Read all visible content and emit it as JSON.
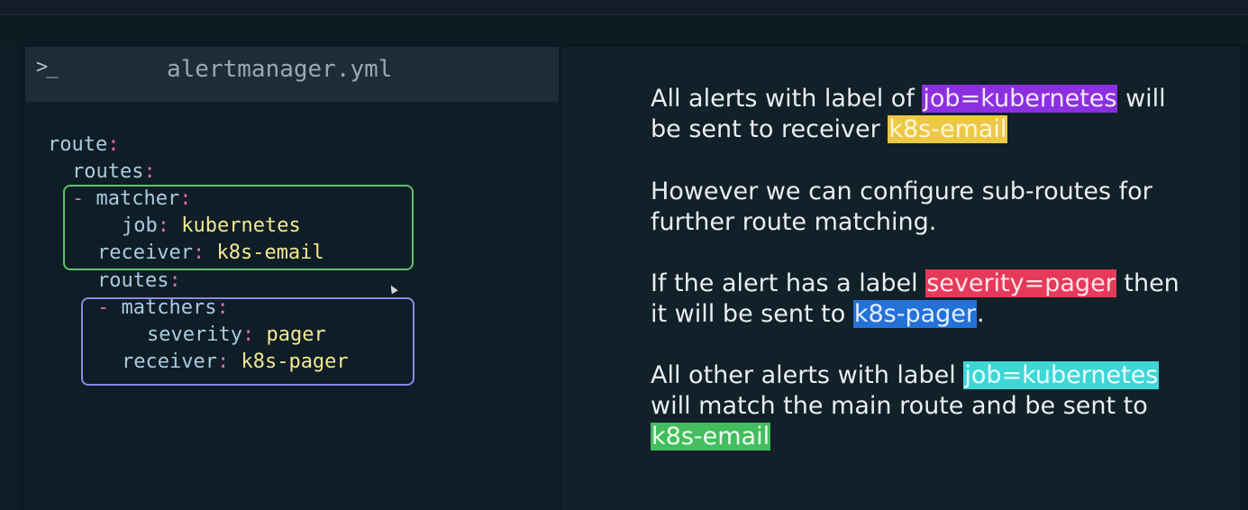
{
  "editor": {
    "prompt_icon": ">_",
    "filename": "alertmanager.yml",
    "lines": [
      {
        "key": "route",
        "punct": ":",
        "value": ""
      },
      {
        "key": "routes",
        "punct": ":",
        "value": ""
      },
      {
        "dash": "- ",
        "key": "matcher",
        "punct": ":",
        "value": ""
      },
      {
        "key": "job",
        "punct": ":",
        "value": " kubernetes"
      },
      {
        "key": "receiver",
        "punct": ":",
        "value": " k8s-email"
      },
      {
        "key": "routes",
        "punct": ":",
        "value": ""
      },
      {
        "dash": "- ",
        "key": "matchers",
        "punct": ":",
        "value": ""
      },
      {
        "key": "severity",
        "punct": ":",
        "value": " pager"
      },
      {
        "key": "receiver",
        "punct": ":",
        "value": " k8s-pager"
      }
    ]
  },
  "explanation": {
    "p1": {
      "line1_pre": "All alerts with label of ",
      "line1_hl": "job=kubernetes",
      "line1_post": " will",
      "line2_pre": "be sent to receiver ",
      "line2_hl": "k8s-email"
    },
    "p2": {
      "line1": "However we can configure sub-routes for",
      "line2": "further route matching."
    },
    "p3": {
      "line1_pre": "If the alert has a label ",
      "line1_hl": "severity=pager",
      "line1_post": " then",
      "line2_pre": "it will be sent to ",
      "line2_hl": "k8s-pager",
      "line2_post": "."
    },
    "p4": {
      "line1_pre": "All other alerts with label ",
      "line1_hl": "job=kubernetes",
      "line2": "will match the main route and be sent to",
      "line3_hl": "k8s-email"
    }
  },
  "colors": {
    "highlight_purple": "#8b2fe0",
    "highlight_yellow": "#ecc845",
    "highlight_red": "#e53a5a",
    "highlight_blue": "#2471d8",
    "highlight_cyan": "#3fd6d6",
    "highlight_green": "#43bd5e",
    "box_green": "#5fc36a",
    "box_blue": "#8d87e6"
  }
}
